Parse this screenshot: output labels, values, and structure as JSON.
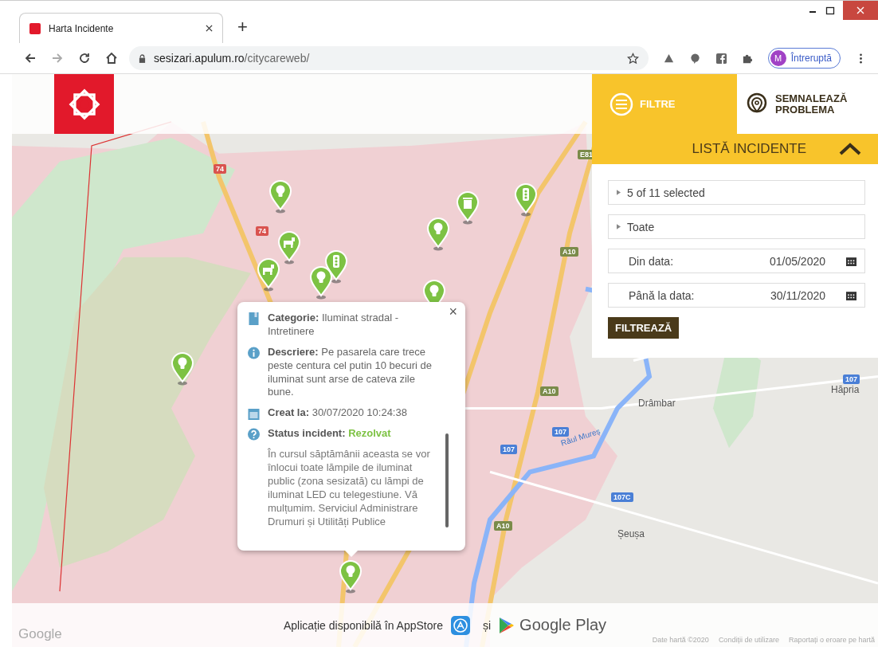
{
  "browser": {
    "tab_title": "Harta Incidente",
    "new_tab": "+",
    "url_host": "sesizari.apulum.ro",
    "url_path": "/citycareweb/",
    "profile_initial": "M",
    "profile_status": "Întreruptă"
  },
  "header": {
    "tabs": [
      {
        "kind": "filters",
        "label": "FILTRE",
        "selected": true
      },
      {
        "kind": "report",
        "label": "SEMNALEAZĂ PROBLEMA",
        "selected": false
      }
    ]
  },
  "panel": {
    "title": "LISTĂ INCIDENTE",
    "expanded": true,
    "dropdowns": [
      "5 of 11 selected",
      "Toate"
    ],
    "dates": [
      {
        "label": "Din data:",
        "value": "01/05/2020"
      },
      {
        "label": "Până la data:",
        "value": "30/11/2020"
      }
    ],
    "button": "FILTREAZĂ"
  },
  "map": {
    "labels": [
      {
        "kind": "road",
        "text": "74"
      },
      {
        "kind": "road",
        "text": "74"
      },
      {
        "kind": "road",
        "text": "E81"
      },
      {
        "kind": "road",
        "text": "A10"
      },
      {
        "kind": "road",
        "text": "A10"
      },
      {
        "kind": "road",
        "text": "107"
      },
      {
        "kind": "road",
        "text": "107"
      },
      {
        "kind": "road",
        "text": "A10"
      },
      {
        "kind": "road",
        "text": "107C"
      },
      {
        "kind": "road",
        "text": "107"
      },
      {
        "kind": "place",
        "text": "Drâmbar"
      },
      {
        "kind": "place",
        "text": "Hăpria"
      },
      {
        "kind": "place",
        "text": "Șeușa"
      },
      {
        "kind": "river",
        "text": "Râul Mureș"
      }
    ],
    "pins": [
      {
        "kind": "bulb"
      },
      {
        "kind": "trash"
      },
      {
        "kind": "traffic"
      },
      {
        "kind": "bulb"
      },
      {
        "kind": "dog"
      },
      {
        "kind": "traffic"
      },
      {
        "kind": "dog"
      },
      {
        "kind": "bulb"
      },
      {
        "kind": "bulb"
      },
      {
        "kind": "bulb"
      },
      {
        "kind": "bulb"
      }
    ]
  },
  "popup": {
    "close": "×",
    "fields": [
      {
        "kind": "category",
        "label": "Categorie:",
        "value": "Iluminat stradal - Intretinere"
      },
      {
        "kind": "description",
        "label": "Descriere:",
        "value": "Pe pasarela care trece peste centura cel putin 10 becuri de iluminat sunt arse de cateva zile bune."
      },
      {
        "kind": "created",
        "label": "Creat la:",
        "value": "30/07/2020 10:24:38"
      },
      {
        "kind": "status",
        "label": "Status incident:",
        "value": "Rezolvat"
      }
    ],
    "response": "În cursul săptămânii aceasta se vor înlocui toate lămpile de iluminat public (zona sesizată) cu lămpi de iluminat LED cu telegestiune. Vă mulțumim. Serviciul Administrare Drumuri și Utilități Publice"
  },
  "footer": {
    "app_text": "Aplicație disponibilă în AppStore",
    "and": "și",
    "store": "Google Play",
    "map_brand": "Google",
    "attributions": [
      "Date hartă ©2020",
      "Condiții de utilizare",
      "Raportați o eroare pe hartă"
    ]
  }
}
